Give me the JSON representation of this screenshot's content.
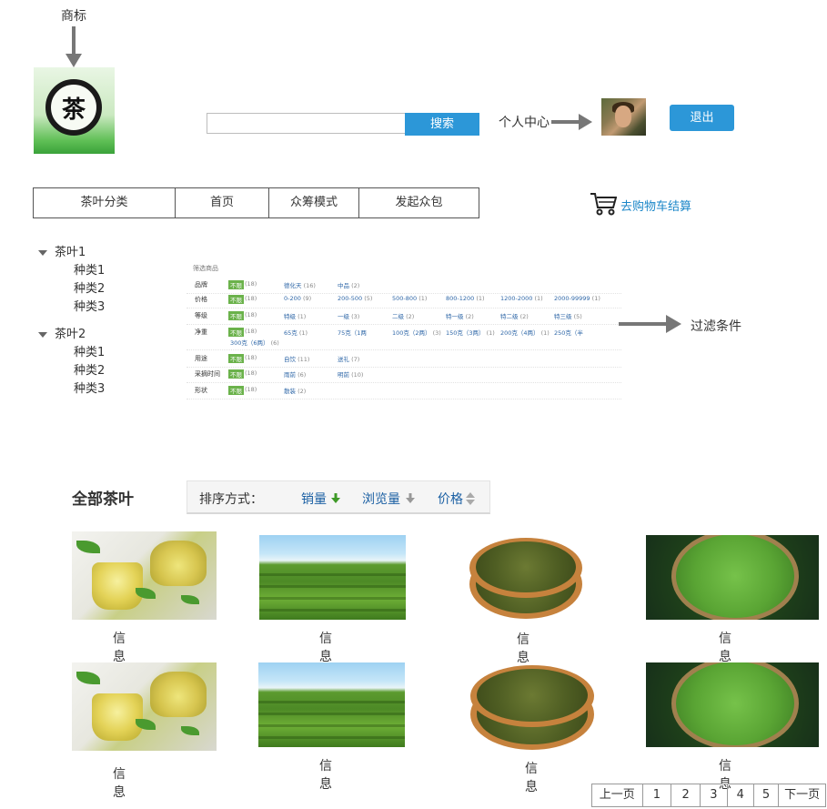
{
  "annotations": {
    "logo_label": "商标",
    "profile_label": "个人中心",
    "filter_label": "过滤条件"
  },
  "header": {
    "logo_text": "茶",
    "search_placeholder": "",
    "search_button": "搜索",
    "logout_button": "退出"
  },
  "nav": {
    "items": [
      "茶叶分类",
      "首页",
      "众筹模式",
      "发起众包"
    ]
  },
  "cart": {
    "label": "去购物车结算"
  },
  "tree": [
    {
      "label": "茶叶1",
      "children": [
        "种类1",
        "种类2",
        "种类3"
      ]
    },
    {
      "label": "茶叶2",
      "children": [
        "种类1",
        "种类2",
        "种类3"
      ]
    }
  ],
  "filter": {
    "header": "筛选商品",
    "all_label": "不限",
    "rows": [
      {
        "label": "品牌",
        "all_count": "(18)",
        "options": [
          {
            "text": "德化天",
            "count": "(16)"
          },
          {
            "text": "中品",
            "count": "(2)"
          }
        ]
      },
      {
        "label": "价格",
        "all_count": "(18)",
        "options": [
          {
            "text": "0-200",
            "count": "(9)"
          },
          {
            "text": "200-500",
            "count": "(5)"
          },
          {
            "text": "500-800",
            "count": "(1)"
          },
          {
            "text": "800-1200",
            "count": "(1)"
          },
          {
            "text": "1200-2000",
            "count": "(1)"
          },
          {
            "text": "2000-99999",
            "count": "(1)"
          }
        ]
      },
      {
        "label": "等级",
        "all_count": "(18)",
        "options": [
          {
            "text": "特级",
            "count": "(1)"
          },
          {
            "text": "一级",
            "count": "(3)"
          },
          {
            "text": "二级",
            "count": "(2)"
          },
          {
            "text": "特一级",
            "count": "(2)"
          },
          {
            "text": "特二级",
            "count": "(2)"
          },
          {
            "text": "特三级",
            "count": "(5)"
          }
        ]
      },
      {
        "label": "净重",
        "all_count": "(18)",
        "options": [
          {
            "text": "65克",
            "count": "(1)"
          },
          {
            "text": "75克（1两",
            "count": ""
          },
          {
            "text": "100克（2两）",
            "count": "(3)"
          },
          {
            "text": "150克（3两）",
            "count": "(1)"
          },
          {
            "text": "200克（4两）",
            "count": "(1)"
          },
          {
            "text": "250克（半",
            "count": ""
          }
        ],
        "wrap": "300克（6两）",
        "wrap_count": "(6)"
      },
      {
        "label": "用途",
        "all_count": "(18)",
        "options": [
          {
            "text": "自饮",
            "count": "(11)"
          },
          {
            "text": "送礼",
            "count": "(7)"
          }
        ]
      },
      {
        "label": "采摘时间",
        "all_count": "(18)",
        "options": [
          {
            "text": "雨前",
            "count": "(6)"
          },
          {
            "text": "明前",
            "count": "(10)"
          }
        ]
      },
      {
        "label": "形状",
        "all_count": "(18)",
        "options": [
          {
            "text": "散装",
            "count": "(2)"
          }
        ]
      }
    ]
  },
  "section": {
    "title": "全部茶叶"
  },
  "sort": {
    "label": "排序方式：",
    "items": [
      "销量",
      "浏览量",
      "价格"
    ]
  },
  "products": [
    {
      "image": "green-tea-cups",
      "info": "信息"
    },
    {
      "image": "tea-plantation",
      "info": "信息"
    },
    {
      "image": "tea-trays",
      "info": "信息"
    },
    {
      "image": "tea-basket",
      "info": "信息"
    },
    {
      "image": "green-tea-cups",
      "info": "信息"
    },
    {
      "image": "tea-plantation",
      "info": "信息"
    },
    {
      "image": "tea-trays",
      "info": "信息"
    },
    {
      "image": "tea-basket",
      "info": "信息"
    }
  ],
  "pagination": {
    "prev": "上一页",
    "pages": [
      "1",
      "2",
      "3",
      "4",
      "5"
    ],
    "next": "下一页"
  },
  "colors": {
    "accent_blue": "#2c97d8",
    "filter_green": "#6bb24b",
    "link_blue": "#1a86c8"
  }
}
